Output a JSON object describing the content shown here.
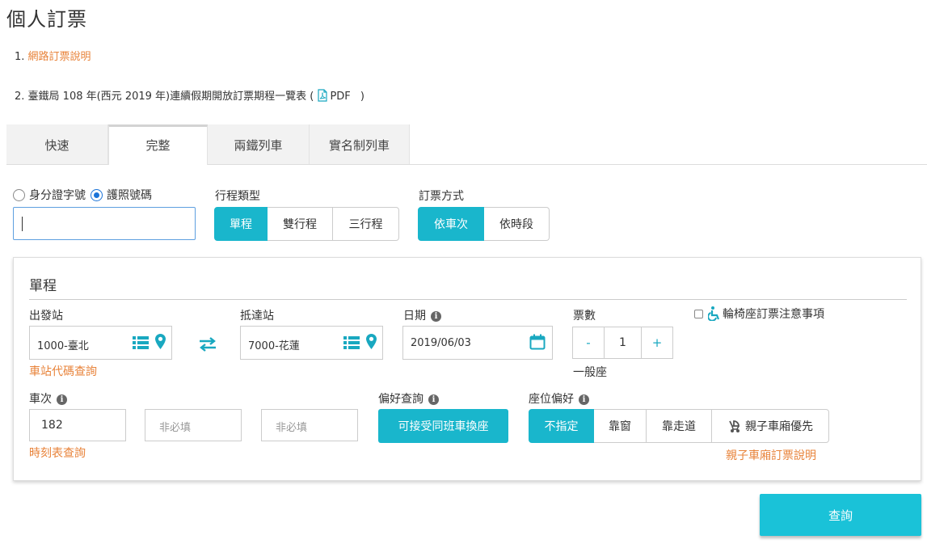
{
  "page_title": "個人訂票",
  "notes": {
    "item1_prefix": "1.",
    "item1_link": "網路訂票說明",
    "item2_text": "2. 臺鐵局 108 年(西元 2019 年)連續假期開放訂票期程一覽表 (",
    "item2_pdf": "PDF",
    "item2_close": ")"
  },
  "tabs": [
    {
      "label": "快速",
      "active": false
    },
    {
      "label": "完整",
      "active": true
    },
    {
      "label": "兩鐵列車",
      "active": false
    },
    {
      "label": "實名制列車",
      "active": false
    }
  ],
  "id_type": {
    "options": [
      "身分證字號",
      "護照號碼"
    ],
    "selected": "護照號碼",
    "value": ""
  },
  "trip_type": {
    "label": "行程類型",
    "options": [
      "單程",
      "雙行程",
      "三行程"
    ],
    "selected": "單程"
  },
  "booking_method": {
    "label": "訂票方式",
    "options": [
      "依車次",
      "依時段"
    ],
    "selected": "依車次"
  },
  "panel": {
    "title": "單程",
    "departure": {
      "label": "出發站",
      "value": "1000-臺北",
      "help_link": "車站代碼查詢"
    },
    "arrival": {
      "label": "抵達站",
      "value": "7000-花蓮"
    },
    "date": {
      "label": "日期",
      "value": "2019/06/03"
    },
    "tickets": {
      "label": "票數",
      "minus": "-",
      "count": "1",
      "plus": "+",
      "seat_class": "一般座"
    },
    "wheelchair": {
      "label": "輪椅座訂票注意事項"
    },
    "train_no": {
      "label": "車次",
      "value": "182",
      "optional1": "非必填",
      "optional2": "非必填",
      "help_link": "時刻表查詢"
    },
    "preference": {
      "label": "偏好查詢",
      "button": "可接受同班車換座"
    },
    "seat_pref": {
      "label": "座位偏好",
      "options": [
        "不指定",
        "靠窗",
        "靠走道",
        "親子車廂優先"
      ],
      "selected": "不指定",
      "help_link": "親子車廂訂票說明"
    }
  },
  "submit_label": "查詢",
  "colors": {
    "accent": "#19b6cc",
    "link": "#e8833a",
    "focus_border": "#5d9fe0"
  }
}
